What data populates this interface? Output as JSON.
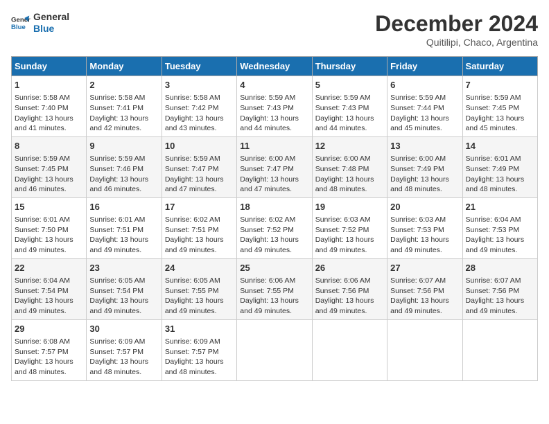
{
  "header": {
    "logo_line1": "General",
    "logo_line2": "Blue",
    "title": "December 2024",
    "subtitle": "Quitilipi, Chaco, Argentina"
  },
  "calendar": {
    "days_of_week": [
      "Sunday",
      "Monday",
      "Tuesday",
      "Wednesday",
      "Thursday",
      "Friday",
      "Saturday"
    ],
    "weeks": [
      [
        null,
        null,
        null,
        null,
        null,
        null,
        null
      ],
      [
        null,
        null,
        null,
        null,
        null,
        null,
        null
      ],
      [
        null,
        null,
        null,
        null,
        null,
        null,
        null
      ],
      [
        null,
        null,
        null,
        null,
        null,
        null,
        null
      ],
      [
        null,
        null,
        null,
        null,
        null,
        null,
        null
      ],
      [
        null,
        null,
        null,
        null,
        null,
        null,
        null
      ]
    ],
    "cells": [
      {
        "day": 1,
        "sunrise": "5:58 AM",
        "sunset": "7:40 PM",
        "daylight": "13 hours and 41 minutes."
      },
      {
        "day": 2,
        "sunrise": "5:58 AM",
        "sunset": "7:41 PM",
        "daylight": "13 hours and 42 minutes."
      },
      {
        "day": 3,
        "sunrise": "5:58 AM",
        "sunset": "7:42 PM",
        "daylight": "13 hours and 43 minutes."
      },
      {
        "day": 4,
        "sunrise": "5:59 AM",
        "sunset": "7:43 PM",
        "daylight": "13 hours and 44 minutes."
      },
      {
        "day": 5,
        "sunrise": "5:59 AM",
        "sunset": "7:43 PM",
        "daylight": "13 hours and 44 minutes."
      },
      {
        "day": 6,
        "sunrise": "5:59 AM",
        "sunset": "7:44 PM",
        "daylight": "13 hours and 45 minutes."
      },
      {
        "day": 7,
        "sunrise": "5:59 AM",
        "sunset": "7:45 PM",
        "daylight": "13 hours and 45 minutes."
      },
      {
        "day": 8,
        "sunrise": "5:59 AM",
        "sunset": "7:45 PM",
        "daylight": "13 hours and 46 minutes."
      },
      {
        "day": 9,
        "sunrise": "5:59 AM",
        "sunset": "7:46 PM",
        "daylight": "13 hours and 46 minutes."
      },
      {
        "day": 10,
        "sunrise": "5:59 AM",
        "sunset": "7:47 PM",
        "daylight": "13 hours and 47 minutes."
      },
      {
        "day": 11,
        "sunrise": "6:00 AM",
        "sunset": "7:47 PM",
        "daylight": "13 hours and 47 minutes."
      },
      {
        "day": 12,
        "sunrise": "6:00 AM",
        "sunset": "7:48 PM",
        "daylight": "13 hours and 48 minutes."
      },
      {
        "day": 13,
        "sunrise": "6:00 AM",
        "sunset": "7:49 PM",
        "daylight": "13 hours and 48 minutes."
      },
      {
        "day": 14,
        "sunrise": "6:01 AM",
        "sunset": "7:49 PM",
        "daylight": "13 hours and 48 minutes."
      },
      {
        "day": 15,
        "sunrise": "6:01 AM",
        "sunset": "7:50 PM",
        "daylight": "13 hours and 49 minutes."
      },
      {
        "day": 16,
        "sunrise": "6:01 AM",
        "sunset": "7:51 PM",
        "daylight": "13 hours and 49 minutes."
      },
      {
        "day": 17,
        "sunrise": "6:02 AM",
        "sunset": "7:51 PM",
        "daylight": "13 hours and 49 minutes."
      },
      {
        "day": 18,
        "sunrise": "6:02 AM",
        "sunset": "7:52 PM",
        "daylight": "13 hours and 49 minutes."
      },
      {
        "day": 19,
        "sunrise": "6:03 AM",
        "sunset": "7:52 PM",
        "daylight": "13 hours and 49 minutes."
      },
      {
        "day": 20,
        "sunrise": "6:03 AM",
        "sunset": "7:53 PM",
        "daylight": "13 hours and 49 minutes."
      },
      {
        "day": 21,
        "sunrise": "6:04 AM",
        "sunset": "7:53 PM",
        "daylight": "13 hours and 49 minutes."
      },
      {
        "day": 22,
        "sunrise": "6:04 AM",
        "sunset": "7:54 PM",
        "daylight": "13 hours and 49 minutes."
      },
      {
        "day": 23,
        "sunrise": "6:05 AM",
        "sunset": "7:54 PM",
        "daylight": "13 hours and 49 minutes."
      },
      {
        "day": 24,
        "sunrise": "6:05 AM",
        "sunset": "7:55 PM",
        "daylight": "13 hours and 49 minutes."
      },
      {
        "day": 25,
        "sunrise": "6:06 AM",
        "sunset": "7:55 PM",
        "daylight": "13 hours and 49 minutes."
      },
      {
        "day": 26,
        "sunrise": "6:06 AM",
        "sunset": "7:56 PM",
        "daylight": "13 hours and 49 minutes."
      },
      {
        "day": 27,
        "sunrise": "6:07 AM",
        "sunset": "7:56 PM",
        "daylight": "13 hours and 49 minutes."
      },
      {
        "day": 28,
        "sunrise": "6:07 AM",
        "sunset": "7:56 PM",
        "daylight": "13 hours and 49 minutes."
      },
      {
        "day": 29,
        "sunrise": "6:08 AM",
        "sunset": "7:57 PM",
        "daylight": "13 hours and 48 minutes."
      },
      {
        "day": 30,
        "sunrise": "6:09 AM",
        "sunset": "7:57 PM",
        "daylight": "13 hours and 48 minutes."
      },
      {
        "day": 31,
        "sunrise": "6:09 AM",
        "sunset": "7:57 PM",
        "daylight": "13 hours and 48 minutes."
      }
    ],
    "labels": {
      "sunrise": "Sunrise:",
      "sunset": "Sunset:",
      "daylight": "Daylight:"
    }
  }
}
